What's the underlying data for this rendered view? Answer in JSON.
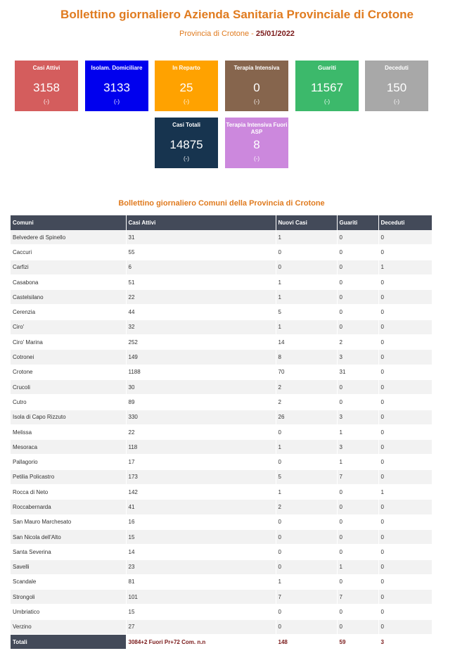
{
  "header": {
    "title": "Bollettino giornaliero Azienda Sanitaria Provinciale di Crotone",
    "subtitle_prefix": "Provincia di Crotone - ",
    "date": "25/01/2022"
  },
  "boxes": [
    {
      "label": "Casi Attivi",
      "value": "3158",
      "change": "(-)",
      "color": "#d45d5d"
    },
    {
      "label": "Isolam. Domiciliare",
      "value": "3133",
      "change": "(-)",
      "color": "#0000ee"
    },
    {
      "label": "In Reparto",
      "value": "25",
      "change": "(-)",
      "color": "#ffa200"
    },
    {
      "label": "Terapia Intensiva",
      "value": "0",
      "change": "(-)",
      "color": "#86654d"
    },
    {
      "label": "Guariti",
      "value": "11567",
      "change": "(-)",
      "color": "#3cb96b"
    },
    {
      "label": "Deceduti",
      "value": "150",
      "change": "(-)",
      "color": "#a8a8a8"
    },
    {
      "label": "Casi Totali",
      "value": "14875",
      "change": "(-)",
      "color": "#17344f"
    },
    {
      "label": "Terapia Intensiva Fuori ASP",
      "value": "8",
      "change": "(-)",
      "color": "#cc88dd"
    }
  ],
  "table": {
    "title": "Bollettino giornaliero Comuni della Provincia di Crotone",
    "headers": [
      "Comuni",
      "Casi Attivi",
      "Nuovi Casi",
      "Guariti",
      "Deceduti"
    ],
    "rows": [
      [
        "Belvedere di Spinello",
        "31",
        "1",
        "0",
        "0"
      ],
      [
        "Caccuri",
        "55",
        "0",
        "0",
        "0"
      ],
      [
        "Carfizi",
        "6",
        "0",
        "0",
        "1"
      ],
      [
        "Casabona",
        "51",
        "1",
        "0",
        "0"
      ],
      [
        "Castelsilano",
        "22",
        "1",
        "0",
        "0"
      ],
      [
        "Cerenzia",
        "44",
        "5",
        "0",
        "0"
      ],
      [
        "Ciro'",
        "32",
        "1",
        "0",
        "0"
      ],
      [
        "Ciro' Marina",
        "252",
        "14",
        "2",
        "0"
      ],
      [
        "Cotronei",
        "149",
        "8",
        "3",
        "0"
      ],
      [
        "Crotone",
        "1188",
        "70",
        "31",
        "0"
      ],
      [
        "Crucoli",
        "30",
        "2",
        "0",
        "0"
      ],
      [
        "Cutro",
        "89",
        "2",
        "0",
        "0"
      ],
      [
        "Isola di Capo Rizzuto",
        "330",
        "26",
        "3",
        "0"
      ],
      [
        "Melissa",
        "22",
        "0",
        "1",
        "0"
      ],
      [
        "Mesoraca",
        "118",
        "1",
        "3",
        "0"
      ],
      [
        "Pallagorio",
        "17",
        "0",
        "1",
        "0"
      ],
      [
        "Petilia Policastro",
        "173",
        "5",
        "7",
        "0"
      ],
      [
        "Rocca di Neto",
        "142",
        "1",
        "0",
        "1"
      ],
      [
        "Roccabernarda",
        "41",
        "2",
        "0",
        "0"
      ],
      [
        "San Mauro Marchesato",
        "16",
        "0",
        "0",
        "0"
      ],
      [
        "San Nicola dell'Alto",
        "15",
        "0",
        "0",
        "0"
      ],
      [
        "Santa Severina",
        "14",
        "0",
        "0",
        "0"
      ],
      [
        "Savelli",
        "23",
        "0",
        "1",
        "0"
      ],
      [
        "Scandale",
        "81",
        "1",
        "0",
        "0"
      ],
      [
        "Strongoli",
        "101",
        "7",
        "7",
        "0"
      ],
      [
        "Umbriatico",
        "15",
        "0",
        "0",
        "0"
      ],
      [
        "Verzino",
        "27",
        "0",
        "0",
        "0"
      ]
    ],
    "totals": [
      "Totali",
      "3084+2 Fuori Pr+72 Com. n.n",
      "148",
      "59",
      "3"
    ]
  }
}
